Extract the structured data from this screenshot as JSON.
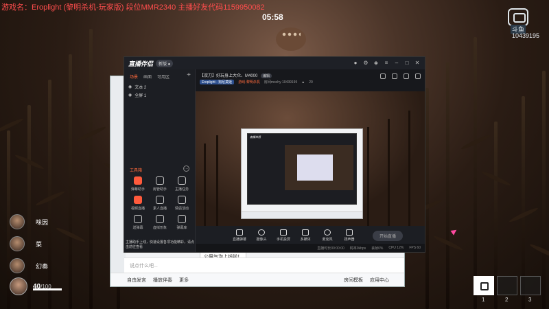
{
  "overlay": {
    "ticker": "游戏名：Eroplight (黎明杀机-玩家版)  段位MMR2340 主播好友代码1159950082",
    "timer": "05:58",
    "brand_name": "斗鱼",
    "room_number": "10439195"
  },
  "team": {
    "members": [
      {
        "name": "咪因"
      },
      {
        "name": "菜"
      },
      {
        "name": "幻奏"
      }
    ],
    "self": {
      "hp": "40",
      "hp_max": "/100"
    }
  },
  "hotbar": {
    "slots": [
      "1",
      "2",
      "3"
    ]
  },
  "chat_window": {
    "tooltip": "公屏气泡上线啦！",
    "input_placeholder": "说点什么吧...",
    "bottom_items": [
      "自由发言",
      "播放伴奏",
      "更多"
    ],
    "right_items": [
      "房间模板",
      "应用中心"
    ]
  },
  "companion": {
    "app_name": "直播伴侣",
    "version": "新版 ●",
    "tabs": [
      "场景",
      "画面",
      "可用区"
    ],
    "active_tab": "场景",
    "scenes": [
      "文本 2",
      "全屏 1"
    ],
    "tools_title": "工具箱",
    "tools": [
      "弹幕助手",
      "房管助手",
      "主播任务",
      "视频直播",
      "素人直播",
      "情侣活动",
      "送弹幕",
      "虚拟形象",
      "弹幕库"
    ],
    "notice": "主播助手上线，快速设置各项功能精彩，请点击前往查看",
    "room_title": "【双刀】好玩身上大众、M4000",
    "room_tag": "编辑",
    "streamer": "Eroplight · 狗尼莫娅",
    "category": "游戏-黎明杀机",
    "room_meta_id": "房间mochy  10439195",
    "room_likes": "20",
    "controls": [
      "直播弹幕",
      "摄像头",
      "手机投屏",
      "多媒体",
      "麦克风",
      "扬声器"
    ],
    "start_label": "开始直播",
    "status": [
      "直播时长00:00:00",
      "码率0kbps",
      "丢帧0%",
      "CPU 12%",
      "FPS 60"
    ]
  },
  "colors": {
    "accent": "#ff6a3c",
    "ticker": "#ff4d4d",
    "cursor": "#ff4aa0"
  }
}
